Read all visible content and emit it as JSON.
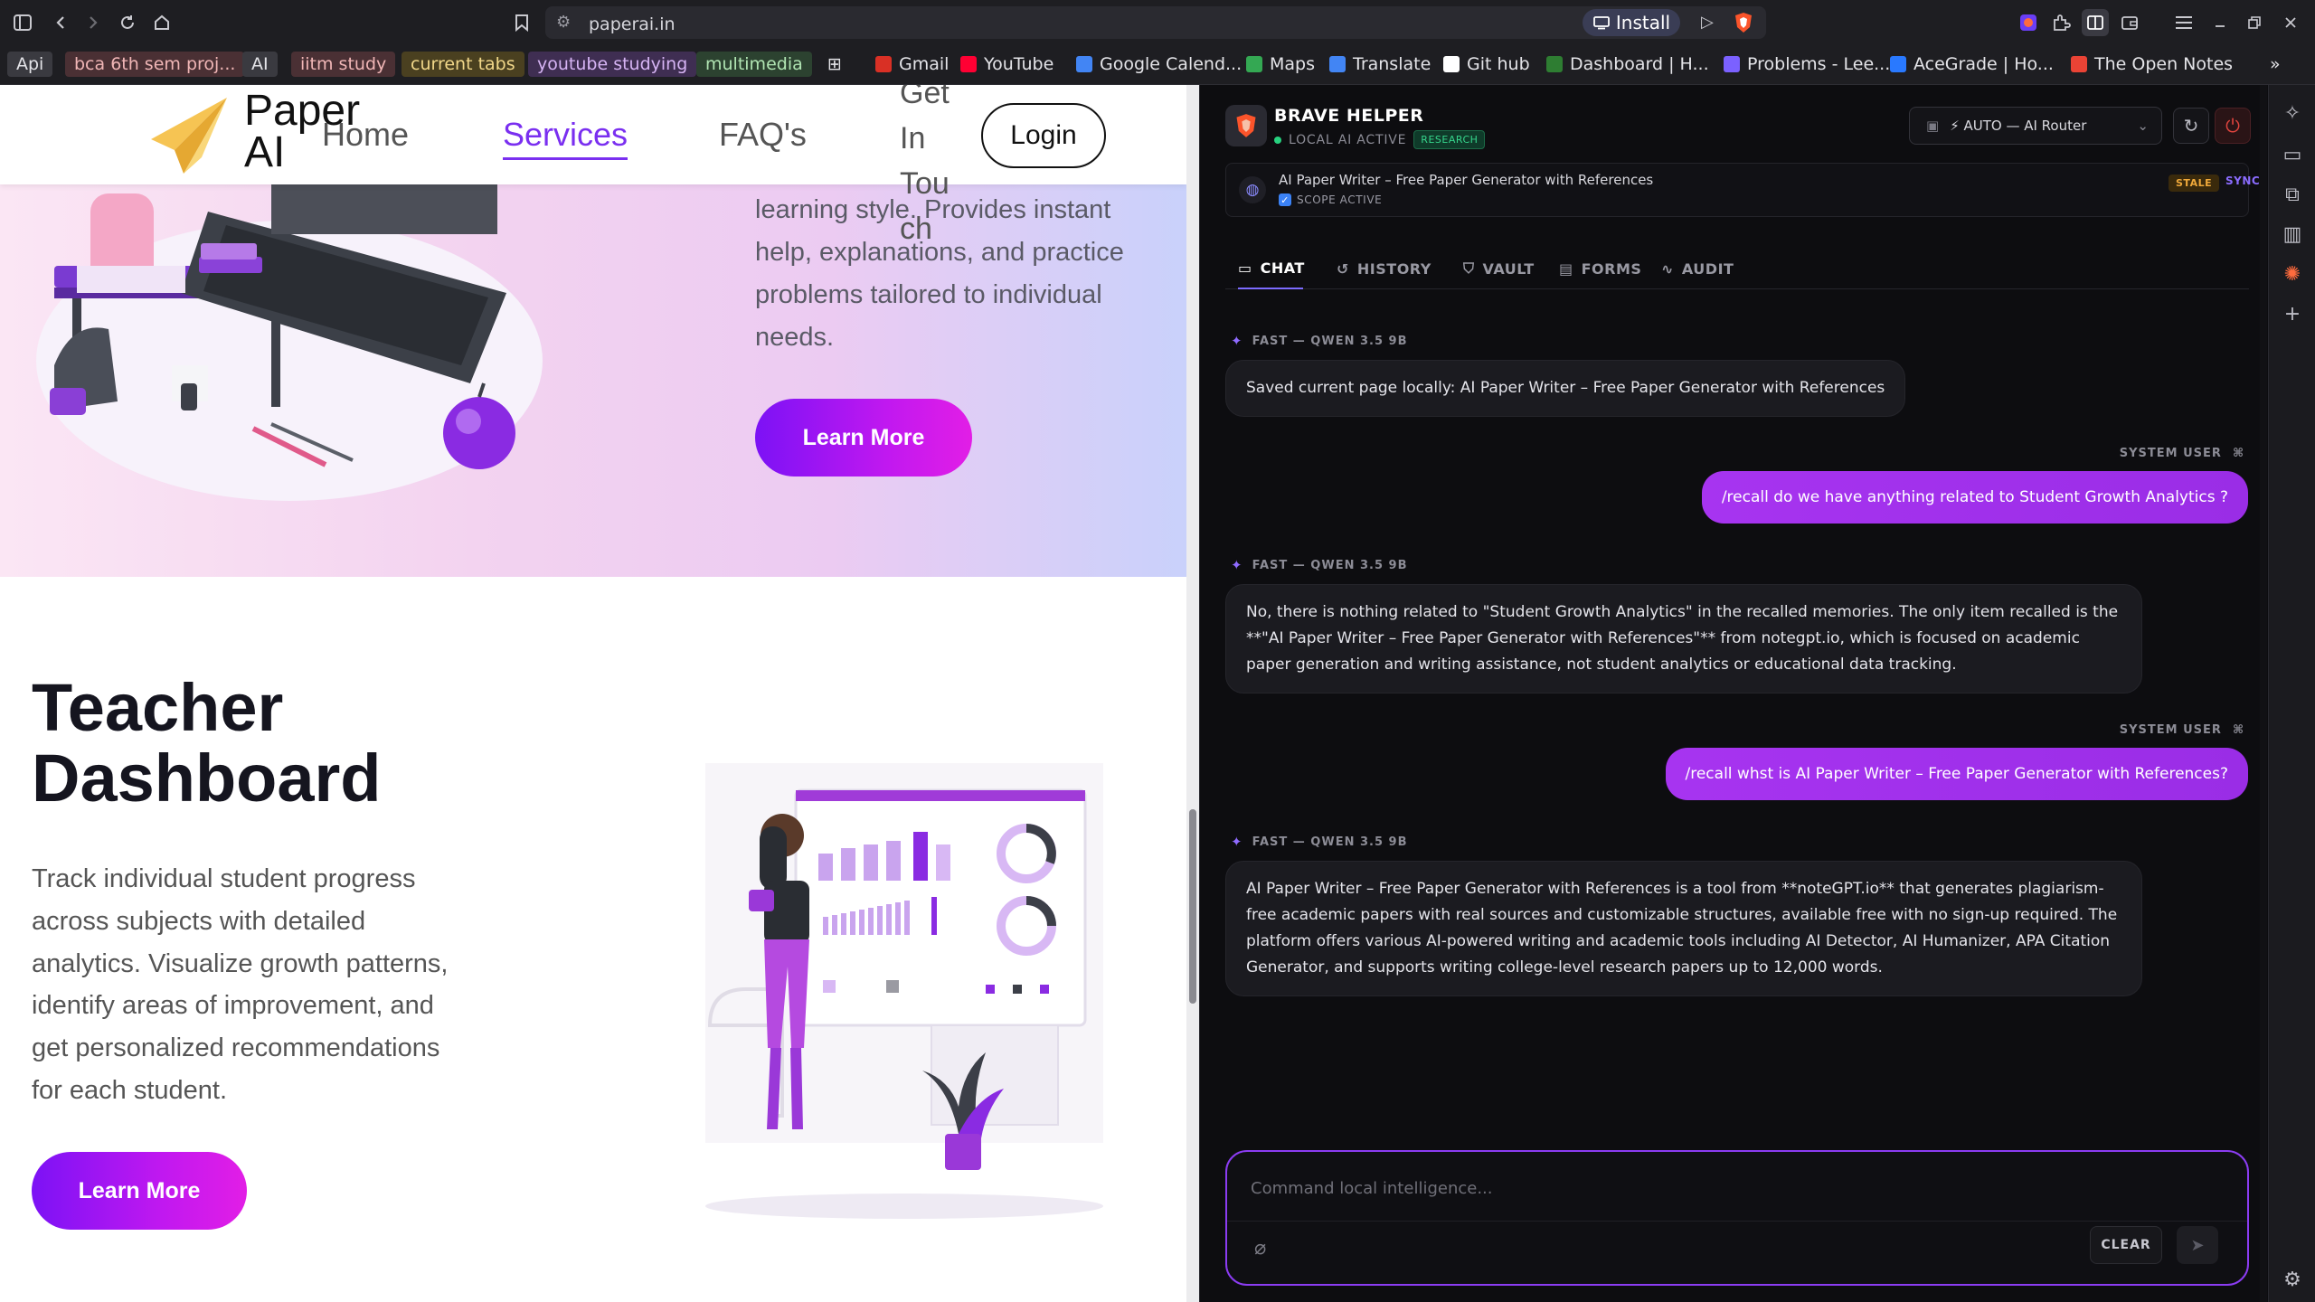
{
  "browser": {
    "url": "paperai.in",
    "install_label": "Install",
    "bookmarks": [
      {
        "label": "Api",
        "bg": "#3a3a40",
        "color": "#e4e4e8"
      },
      {
        "label": "bca 6th sem proj...",
        "bg": "#4a3034",
        "color": "#f0b6b6"
      },
      {
        "label": "AI",
        "bg": "#3a3a40",
        "color": "#e4e4e8"
      },
      {
        "label": "iitm study",
        "bg": "#4a3034",
        "color": "#f0b6b6"
      },
      {
        "label": "current tabs",
        "bg": "#4a4020",
        "color": "#f2d88a"
      },
      {
        "label": "youtube studying",
        "bg": "#3f2e52",
        "color": "#d6b4f4"
      },
      {
        "label": "multimedia",
        "bg": "#2c4230",
        "color": "#b0e4b2"
      },
      {
        "label": "Gmail",
        "bg": "transparent",
        "color": "#e4e4e8",
        "icon": "#d93025"
      },
      {
        "label": "YouTube",
        "bg": "transparent",
        "color": "#e4e4e8",
        "icon": "#ff0033"
      },
      {
        "label": "Google Calend...",
        "bg": "transparent",
        "color": "#e4e4e8",
        "icon": "#4285f4"
      },
      {
        "label": "Maps",
        "bg": "transparent",
        "color": "#e4e4e8",
        "icon": "#34a853"
      },
      {
        "label": "Translate",
        "bg": "transparent",
        "color": "#e4e4e8",
        "icon": "#4285f4"
      },
      {
        "label": "Git hub",
        "bg": "transparent",
        "color": "#e4e4e8",
        "icon": "#ffffff"
      },
      {
        "label": "Dashboard | H...",
        "bg": "transparent",
        "color": "#e4e4e8",
        "icon": "#2e7d32"
      },
      {
        "label": "Problems - Lee...",
        "bg": "transparent",
        "color": "#e4e4e8",
        "icon": "#7b61ff"
      },
      {
        "label": "AceGrade | Ho...",
        "bg": "transparent",
        "color": "#e4e4e8",
        "icon": "#2979ff"
      },
      {
        "label": "The Open Notes",
        "bg": "transparent",
        "color": "#e4e4e8",
        "icon": "#ea4335"
      }
    ]
  },
  "site": {
    "logo_line1": "Paper",
    "logo_line2": "AI",
    "nav": {
      "home": "Home",
      "services": "Services",
      "faqs": "FAQ's",
      "contact": "Get In Touch",
      "login": "Login"
    },
    "hero_text": "learning style. Provides instant help, explanations, and practice problems tailored to individual needs.",
    "hero_button": "Learn More",
    "section_title_1": "Teacher",
    "section_title_2": "Dashboard",
    "section_text": "Track individual student progress across subjects with detailed analytics. Visualize growth patterns, identify areas of improvement, and get personalized recommendations for each student.",
    "section_button": "Learn More"
  },
  "panel": {
    "title": "BRAVE HELPER",
    "status": "LOCAL AI ACTIVE",
    "mode_badge": "RESEARCH",
    "router": "⚡ AUTO — AI Router",
    "scope_page": "AI Paper Writer – Free Paper Generator with References",
    "scope_status": "SCOPE ACTIVE",
    "stale": "STALE",
    "sync": "SYNC",
    "tabs": [
      "CHAT",
      "HISTORY",
      "VAULT",
      "FORMS",
      "AUDIT"
    ],
    "messages": [
      {
        "role": "ai",
        "label": "FAST — QWEN 3.5 9B",
        "text": "Saved current page locally: AI Paper Writer – Free Paper Generator with References"
      },
      {
        "role": "user",
        "label": "SYSTEM USER",
        "text": "/recall do we have anything related to Student Growth Analytics ?"
      },
      {
        "role": "ai",
        "label": "FAST — QWEN 3.5 9B",
        "text": "No, there is nothing related to \"Student Growth Analytics\" in the recalled memories. The only item recalled is the **\"AI Paper Writer – Free Paper Generator with References\"** from notegpt.io, which is focused on academic paper generation and writing assistance, not student analytics or educational data tracking."
      },
      {
        "role": "user",
        "label": "SYSTEM USER",
        "text": "/recall whst is AI Paper Writer – Free Paper Generator with References?"
      },
      {
        "role": "ai",
        "label": "FAST — QWEN 3.5 9B",
        "text": "AI Paper Writer – Free Paper Generator with References is a tool from **noteGPT.io** that generates plagiarism-free academic papers with real sources and customizable structures, available free with no sign-up required. The platform offers various AI-powered writing and academic tools including AI Detector, AI Humanizer, APA Citation Generator, and supports writing college-level research papers up to 12,000 words."
      }
    ],
    "composer_placeholder": "Command local intelligence...",
    "clear_label": "CLEAR"
  }
}
